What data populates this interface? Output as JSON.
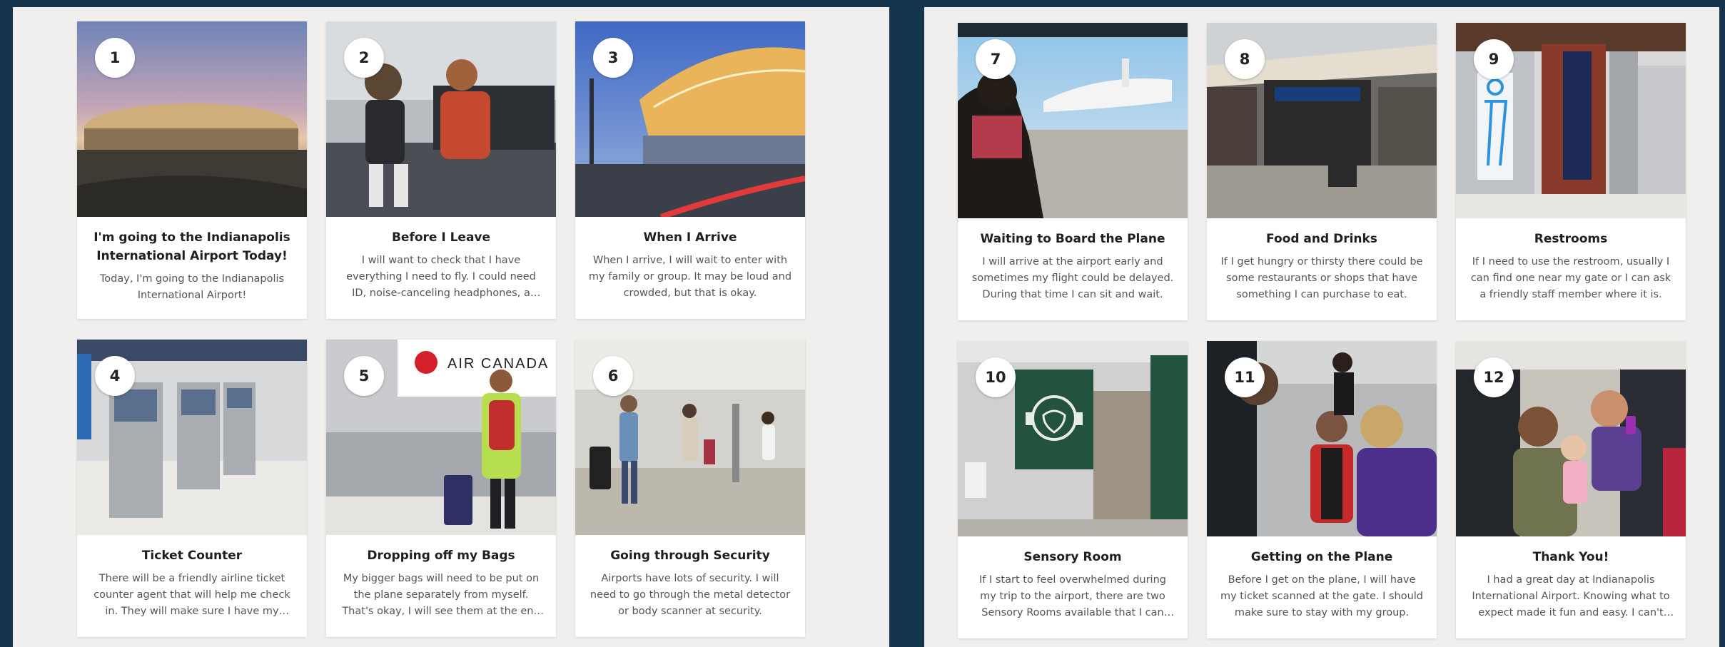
{
  "colors": {
    "background": "#15344d",
    "panel": "#f0efed",
    "card": "#ffffff",
    "title_text": "#1f1f1f",
    "body_text": "#555555"
  },
  "left_panel": {
    "cards": [
      {
        "number": "1",
        "title": "I'm going to the Indianapolis International Airport Today!",
        "text": "Today, I'm going to the Indianapolis International Airport!",
        "image": "airport-terminal-exterior-dusk"
      },
      {
        "number": "2",
        "title": "Before I Leave",
        "text": "I will want to check that I have everything I need to fly. I could need ID, noise-canceling headphones, a tablet and snacks.",
        "image": "kids-with-headphones-at-gate"
      },
      {
        "number": "3",
        "title": "When I Arrive",
        "text": "When I arrive, I will wait to enter with my family or group. It may be loud and crowded, but that is okay.",
        "image": "terminal-entrance-at-night"
      },
      {
        "number": "4",
        "title": "Ticket Counter",
        "text": "There will be a friendly airline ticket counter agent that will help me check in. They will make sure I have my boarding pass.",
        "image": "self-service-kiosks"
      },
      {
        "number": "5",
        "title": "Dropping off my Bags",
        "text": "My bigger bags will need to be put on the plane separately from myself. That's okay, I will see them at the end of my trip.",
        "image": "air-canada-baggage-counter"
      },
      {
        "number": "6",
        "title": "Going through Security",
        "text": "Airports have lots of security. I will need to go through the metal detector or body scanner at security.",
        "image": "travelers-walking-to-security"
      }
    ]
  },
  "right_panel": {
    "cards": [
      {
        "number": "7",
        "title": "Waiting to Board the Plane",
        "text": "I will arrive at the airport early and sometimes my flight could be delayed. During that time I can sit and wait.",
        "image": "child-watching-plane-at-window"
      },
      {
        "number": "8",
        "title": "Food and Drinks",
        "text": "If I get hungry or thirsty there could be some restaurants or shops that have something I can purchase to eat.",
        "image": "concourse-restaurants"
      },
      {
        "number": "9",
        "title": "Restrooms",
        "text": "If I need to use the restroom, usually I can find one near my gate or I can ask a friendly staff member where it is.",
        "image": "restroom-entrance-signage"
      },
      {
        "number": "10",
        "title": "Sensory Room",
        "text": "If I start to feel overwhelmed during my trip to the airport, there are two Sensory Rooms available that I can use.",
        "image": "sensory-room-door"
      },
      {
        "number": "11",
        "title": "Getting on the Plane",
        "text": "Before I get on the plane, I will have my ticket scanned at the gate. I should make sure to stay with my group.",
        "image": "boy-at-boarding-gate"
      },
      {
        "number": "12",
        "title": "Thank You!",
        "text": "I had a great day at Indianapolis International Airport. Knowing what to expect made it fun and easy. I can't wait to fly again!",
        "image": "family-selfie-on-plane"
      }
    ]
  }
}
